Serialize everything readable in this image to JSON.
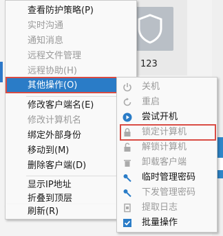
{
  "background": {
    "card_label": "123"
  },
  "context_menu": {
    "items": [
      {
        "label": "查看防护策略(P)",
        "disabled": false
      },
      {
        "label": "实时沟通",
        "disabled": true
      },
      {
        "label": "通知消息",
        "disabled": true
      },
      {
        "label": "远程文件管理",
        "disabled": true
      },
      {
        "label": "远程协助(H)",
        "disabled": true
      },
      {
        "label": "其他操作(O)",
        "disabled": false,
        "active": true,
        "has_submenu": true
      },
      {
        "label": "修改客户端名(E)",
        "disabled": false
      },
      {
        "label": "修改计算机名",
        "disabled": true
      },
      {
        "label": "绑定外部身份",
        "disabled": false
      },
      {
        "label": "移动到(M)",
        "disabled": false
      },
      {
        "label": "删除客户端(D)",
        "disabled": false
      },
      {
        "label": "显示IP地址",
        "disabled": false
      },
      {
        "label": "折叠到顶层",
        "disabled": false
      },
      {
        "label": "刷新(R)",
        "disabled": false
      }
    ],
    "submenu_arrow": "▶"
  },
  "submenu": {
    "items": [
      {
        "label": "关机",
        "icon": "power-icon",
        "disabled": true
      },
      {
        "label": "重启",
        "icon": "restart-icon",
        "disabled": true
      },
      {
        "label": "尝试开机",
        "icon": "play-icon",
        "disabled": false
      },
      {
        "label": "锁定计算机",
        "icon": "lock-icon",
        "disabled": true,
        "highlighted": true
      },
      {
        "label": "解锁计算机",
        "icon": "unlock-icon",
        "disabled": true
      },
      {
        "label": "卸载客户端",
        "icon": "trash-icon",
        "disabled": true
      },
      {
        "label": "临时管理密码",
        "icon": "key-icon",
        "disabled": false
      },
      {
        "label": "下发管理密码",
        "icon": "key-icon",
        "disabled": true
      },
      {
        "label": "提取日志",
        "icon": "log-icon",
        "disabled": true
      },
      {
        "label": "批量操作",
        "icon": "checkbox-icon",
        "disabled": false
      }
    ],
    "colors": {
      "accent": "#2a7cc7",
      "highlight_border": "#d94b43"
    }
  }
}
